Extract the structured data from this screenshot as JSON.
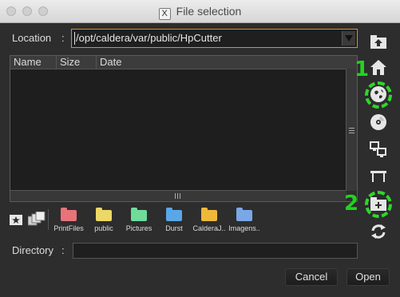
{
  "window": {
    "title": "File selection",
    "title_icon": "X"
  },
  "location": {
    "label": "Location",
    "colon": ":",
    "value": "/opt/caldera/var/public/HpCutter"
  },
  "list": {
    "columns": [
      "Name",
      "Size",
      "Date"
    ]
  },
  "favorites": [
    {
      "label": "PrintFiles",
      "color": "#e8737a"
    },
    {
      "label": "public",
      "color": "#ecd866"
    },
    {
      "label": "Pictures",
      "color": "#6fdc9a"
    },
    {
      "label": "Durst",
      "color": "#5aa7e8"
    },
    {
      "label": "CalderaJ..",
      "color": "#eeb83a"
    },
    {
      "label": "Imagens..",
      "color": "#7aa8e6"
    }
  ],
  "directory": {
    "label": "Directory",
    "colon": ":",
    "value": ""
  },
  "buttons": {
    "cancel": "Cancel",
    "open": "Open"
  },
  "sidebar_icons": [
    "parent-folder-icon",
    "home-icon",
    "network-icon",
    "disc-icon",
    "computers-icon",
    "table-icon",
    "new-folder-icon",
    "refresh-icon"
  ],
  "annotations": {
    "one": "1",
    "two": "2",
    "color": "#22d31f"
  }
}
